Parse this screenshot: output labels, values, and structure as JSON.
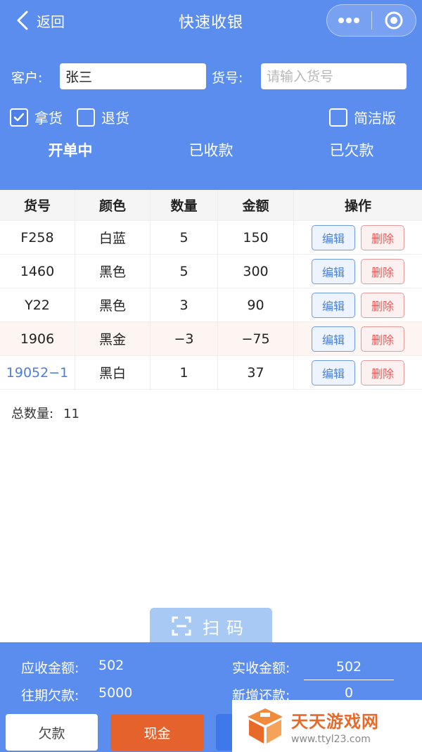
{
  "nav": {
    "back_label": "返回",
    "title": "快速收银"
  },
  "form": {
    "customer_label": "客户:",
    "customer_value": "张三",
    "item_no_label": "货号:",
    "item_no_placeholder": "请输入货号"
  },
  "options": {
    "take_goods": "拿货",
    "return_goods": "退货",
    "simple_mode": "简洁版"
  },
  "status_tabs": [
    "开单中",
    "已收款",
    "已欠款"
  ],
  "table": {
    "headers": [
      "货号",
      "颜色",
      "数量",
      "金额",
      "操作"
    ],
    "edit_label": "编辑",
    "delete_label": "删除",
    "rows": [
      {
        "item_no": "F258",
        "color": "白蓝",
        "qty": "5",
        "amount": "150"
      },
      {
        "item_no": "1460",
        "color": "黑色",
        "qty": "5",
        "amount": "300"
      },
      {
        "item_no": "Y22",
        "color": "黑色",
        "qty": "3",
        "amount": "90"
      },
      {
        "item_no": "1906",
        "color": "黑金",
        "qty": "−3",
        "amount": "−75"
      },
      {
        "item_no": "19052−1",
        "color": "黑白",
        "qty": "1",
        "amount": "37"
      }
    ]
  },
  "summary": {
    "total_qty_label": "总数量:",
    "total_qty": "11"
  },
  "scan": {
    "label": "扫码"
  },
  "footer": {
    "receivable_label": "应收金额:",
    "receivable": "502",
    "paid_label": "实收金额:",
    "paid": "502",
    "prior_debt_label": "往期欠款:",
    "prior_debt": "5000",
    "new_label": "新增还款:",
    "new_value": "0",
    "btn_debt": "欠款",
    "btn_cash": "现金"
  },
  "watermark": {
    "title": "天天游戏网",
    "url": "www.ttyl23.com"
  },
  "colors": {
    "primary": "#5b8def",
    "cash": "#e5622c",
    "link": "#4b7fd6",
    "delete": "#e06060"
  }
}
